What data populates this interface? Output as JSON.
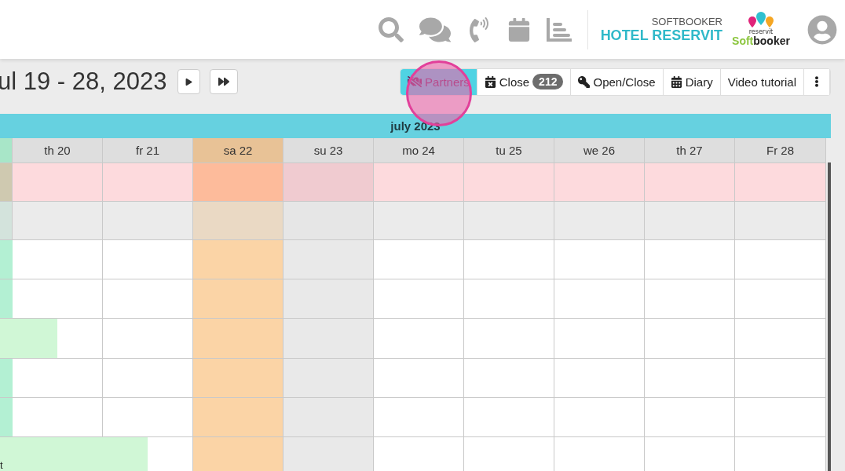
{
  "header": {
    "brand_caption": "SOFTBOOKER",
    "hotel_name": "HOTEL RESERVIT",
    "logo": {
      "tagline": "reservit",
      "wordmark_start": "Soft",
      "wordmark_end": "booker"
    }
  },
  "period": {
    "title": "ul 19 - 28, 2023"
  },
  "toolbar": [
    {
      "kind": "partners",
      "label": "Partners",
      "selected": true
    },
    {
      "kind": "close",
      "label": "Close",
      "count": "212",
      "selected": false
    },
    {
      "kind": "openclose",
      "label": "Open/Close",
      "selected": false
    },
    {
      "kind": "diary",
      "label": "Diary",
      "selected": false
    },
    {
      "kind": "video",
      "label": "Video tutorial",
      "selected": false
    },
    {
      "kind": "more",
      "selected": false
    }
  ],
  "click_highlight": true,
  "calendar": {
    "month": "july 2023",
    "days": [
      {
        "label": "th 20",
        "kind": "weekday"
      },
      {
        "label": "fr 21",
        "kind": "weekday"
      },
      {
        "label": "sa 22",
        "kind": "saturday"
      },
      {
        "label": "su 23",
        "kind": "sunday"
      },
      {
        "label": "mo 24",
        "kind": "weekday"
      },
      {
        "label": "tu 25",
        "kind": "weekday"
      },
      {
        "label": "we 26",
        "kind": "weekday"
      },
      {
        "label": "th 27",
        "kind": "weekday"
      },
      {
        "label": "Fr 28",
        "kind": "weekday"
      }
    ],
    "rows": [
      {
        "kind": "prices"
      },
      {
        "kind": "availability"
      },
      {
        "kind": "room",
        "booking": {
          "kind": "edge"
        }
      },
      {
        "kind": "room",
        "booking": {
          "kind": "edge"
        }
      },
      {
        "kind": "room",
        "booking": {
          "kind": "short"
        }
      },
      {
        "kind": "room",
        "booking": {
          "kind": "edge"
        }
      },
      {
        "kind": "room",
        "booking": {
          "kind": "edge"
        }
      },
      {
        "kind": "room",
        "booking": {
          "kind": "long",
          "label": "t"
        }
      }
    ]
  }
}
